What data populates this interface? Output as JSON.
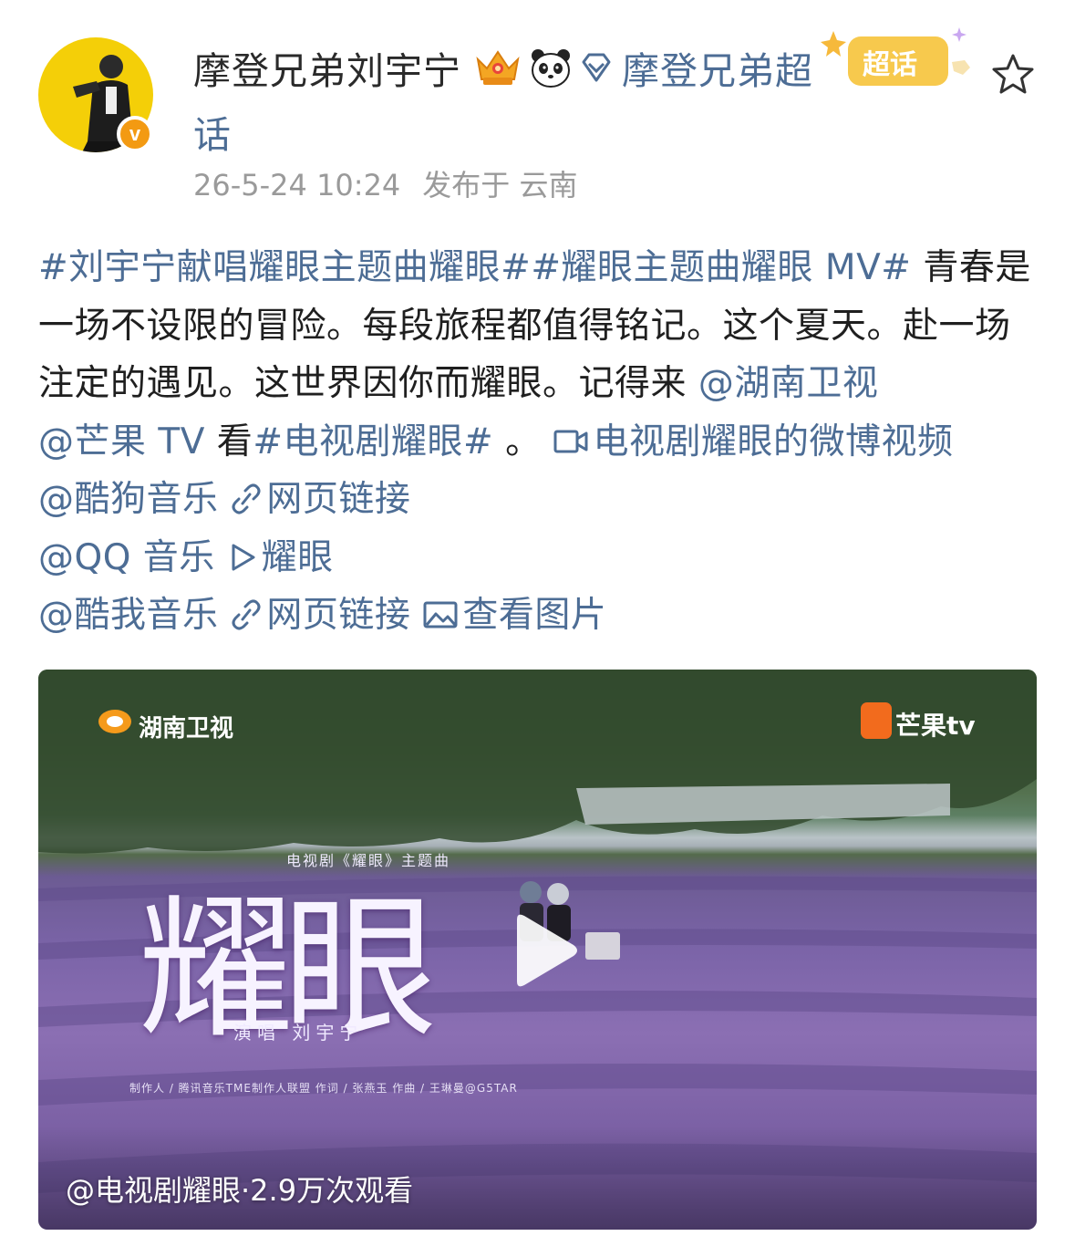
{
  "post": {
    "username": "摩登兄弟刘宇宁",
    "super_topic_line1": "摩登兄弟超",
    "super_topic_line2": "话",
    "super_topic_badge": "超话",
    "timestamp": "26-5-24 10:24",
    "location": "发布于 云南"
  },
  "content": {
    "tag1": "#刘宇宁献唱耀眼主题曲耀眼#",
    "tag2": "#耀眼主题曲耀眼 MV#",
    "text1": " 青春是一场不设限的冒险。每段旅程都值得铭记。这个夏天。赴一场注定的遇见。这世界因你而耀眼。记得来",
    "mention1": "@湖南卫视",
    "mention2": "@芒果 TV",
    "text2": " 看",
    "tag3": "#电视剧耀眼#",
    "text3": " 。",
    "video_link": "电视剧耀眼的微博视频",
    "mention3": "@酷狗音乐",
    "web_link1": "网页链接",
    "mention4": "@QQ 音乐",
    "play_link": "耀眼",
    "mention5": "@酷我音乐",
    "web_link2": "网页链接",
    "image_link": "查看图片"
  },
  "video": {
    "channel_logo_left": "湖南卫视",
    "channel_logo_right": "芒果tv",
    "title_art": "耀眼",
    "subtitle_art": "电视剧《耀眼》主题曲",
    "singer_art": "演唱 刘宇宁",
    "credits_art": "制作人 / 腾讯音乐TME制作人联盟    作词 / 张燕玉    作曲 / 王琳曼@G5TAR",
    "caption": "@电视剧耀眼·2.9万次观看"
  },
  "colors": {
    "link": "#4d6d95",
    "text": "#1f1f1f",
    "meta": "#9a9a9a",
    "verified": "#f39a12"
  }
}
